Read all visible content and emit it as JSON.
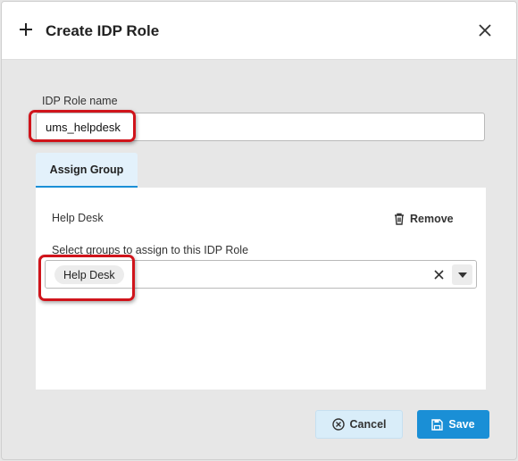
{
  "dialog": {
    "title": "Create IDP Role",
    "icons": {
      "title": "plus-icon",
      "close": "close-icon"
    }
  },
  "form": {
    "role_name_label": "IDP Role name",
    "role_name_value": "ums_helpdesk"
  },
  "tabs": [
    {
      "label": "Assign Group",
      "active": true
    }
  ],
  "assign_group": {
    "group_name": "Help Desk",
    "remove_label": "Remove",
    "remove_icon": "trash-icon",
    "select_label": "Select groups to assign to this IDP Role",
    "selected_groups": [
      "Help Desk"
    ]
  },
  "footer": {
    "cancel_label": "Cancel",
    "cancel_icon": "cancel-circle-icon",
    "save_label": "Save",
    "save_icon": "save-icon"
  },
  "colors": {
    "accent": "#1a8fd6",
    "highlight": "#d0141b",
    "tab_background": "#e3f1fb",
    "cancel_background": "#d9edf9"
  }
}
